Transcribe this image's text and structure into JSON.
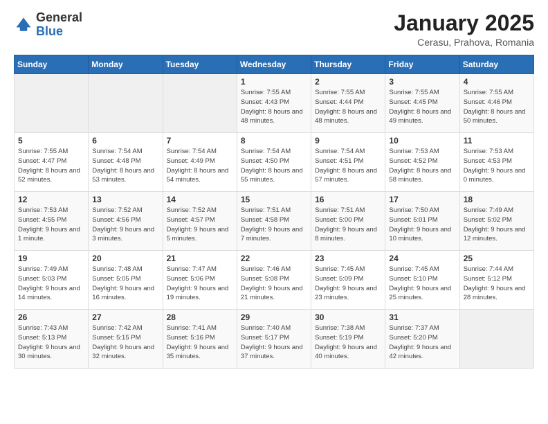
{
  "logo": {
    "general": "General",
    "blue": "Blue"
  },
  "header": {
    "month": "January 2025",
    "location": "Cerasu, Prahova, Romania"
  },
  "weekdays": [
    "Sunday",
    "Monday",
    "Tuesday",
    "Wednesday",
    "Thursday",
    "Friday",
    "Saturday"
  ],
  "weeks": [
    [
      {
        "day": "",
        "empty": true
      },
      {
        "day": "",
        "empty": true
      },
      {
        "day": "",
        "empty": true
      },
      {
        "day": "1",
        "sunrise": "7:55 AM",
        "sunset": "4:43 PM",
        "daylight": "8 hours and 48 minutes."
      },
      {
        "day": "2",
        "sunrise": "7:55 AM",
        "sunset": "4:44 PM",
        "daylight": "8 hours and 48 minutes."
      },
      {
        "day": "3",
        "sunrise": "7:55 AM",
        "sunset": "4:45 PM",
        "daylight": "8 hours and 49 minutes."
      },
      {
        "day": "4",
        "sunrise": "7:55 AM",
        "sunset": "4:46 PM",
        "daylight": "8 hours and 50 minutes."
      }
    ],
    [
      {
        "day": "5",
        "sunrise": "7:55 AM",
        "sunset": "4:47 PM",
        "daylight": "8 hours and 52 minutes."
      },
      {
        "day": "6",
        "sunrise": "7:54 AM",
        "sunset": "4:48 PM",
        "daylight": "8 hours and 53 minutes."
      },
      {
        "day": "7",
        "sunrise": "7:54 AM",
        "sunset": "4:49 PM",
        "daylight": "8 hours and 54 minutes."
      },
      {
        "day": "8",
        "sunrise": "7:54 AM",
        "sunset": "4:50 PM",
        "daylight": "8 hours and 55 minutes."
      },
      {
        "day": "9",
        "sunrise": "7:54 AM",
        "sunset": "4:51 PM",
        "daylight": "8 hours and 57 minutes."
      },
      {
        "day": "10",
        "sunrise": "7:53 AM",
        "sunset": "4:52 PM",
        "daylight": "8 hours and 58 minutes."
      },
      {
        "day": "11",
        "sunrise": "7:53 AM",
        "sunset": "4:53 PM",
        "daylight": "9 hours and 0 minutes."
      }
    ],
    [
      {
        "day": "12",
        "sunrise": "7:53 AM",
        "sunset": "4:55 PM",
        "daylight": "9 hours and 1 minute."
      },
      {
        "day": "13",
        "sunrise": "7:52 AM",
        "sunset": "4:56 PM",
        "daylight": "9 hours and 3 minutes."
      },
      {
        "day": "14",
        "sunrise": "7:52 AM",
        "sunset": "4:57 PM",
        "daylight": "9 hours and 5 minutes."
      },
      {
        "day": "15",
        "sunrise": "7:51 AM",
        "sunset": "4:58 PM",
        "daylight": "9 hours and 7 minutes."
      },
      {
        "day": "16",
        "sunrise": "7:51 AM",
        "sunset": "5:00 PM",
        "daylight": "9 hours and 8 minutes."
      },
      {
        "day": "17",
        "sunrise": "7:50 AM",
        "sunset": "5:01 PM",
        "daylight": "9 hours and 10 minutes."
      },
      {
        "day": "18",
        "sunrise": "7:49 AM",
        "sunset": "5:02 PM",
        "daylight": "9 hours and 12 minutes."
      }
    ],
    [
      {
        "day": "19",
        "sunrise": "7:49 AM",
        "sunset": "5:03 PM",
        "daylight": "9 hours and 14 minutes."
      },
      {
        "day": "20",
        "sunrise": "7:48 AM",
        "sunset": "5:05 PM",
        "daylight": "9 hours and 16 minutes."
      },
      {
        "day": "21",
        "sunrise": "7:47 AM",
        "sunset": "5:06 PM",
        "daylight": "9 hours and 19 minutes."
      },
      {
        "day": "22",
        "sunrise": "7:46 AM",
        "sunset": "5:08 PM",
        "daylight": "9 hours and 21 minutes."
      },
      {
        "day": "23",
        "sunrise": "7:45 AM",
        "sunset": "5:09 PM",
        "daylight": "9 hours and 23 minutes."
      },
      {
        "day": "24",
        "sunrise": "7:45 AM",
        "sunset": "5:10 PM",
        "daylight": "9 hours and 25 minutes."
      },
      {
        "day": "25",
        "sunrise": "7:44 AM",
        "sunset": "5:12 PM",
        "daylight": "9 hours and 28 minutes."
      }
    ],
    [
      {
        "day": "26",
        "sunrise": "7:43 AM",
        "sunset": "5:13 PM",
        "daylight": "9 hours and 30 minutes."
      },
      {
        "day": "27",
        "sunrise": "7:42 AM",
        "sunset": "5:15 PM",
        "daylight": "9 hours and 32 minutes."
      },
      {
        "day": "28",
        "sunrise": "7:41 AM",
        "sunset": "5:16 PM",
        "daylight": "9 hours and 35 minutes."
      },
      {
        "day": "29",
        "sunrise": "7:40 AM",
        "sunset": "5:17 PM",
        "daylight": "9 hours and 37 minutes."
      },
      {
        "day": "30",
        "sunrise": "7:38 AM",
        "sunset": "5:19 PM",
        "daylight": "9 hours and 40 minutes."
      },
      {
        "day": "31",
        "sunrise": "7:37 AM",
        "sunset": "5:20 PM",
        "daylight": "9 hours and 42 minutes."
      },
      {
        "day": "",
        "empty": true
      }
    ]
  ]
}
